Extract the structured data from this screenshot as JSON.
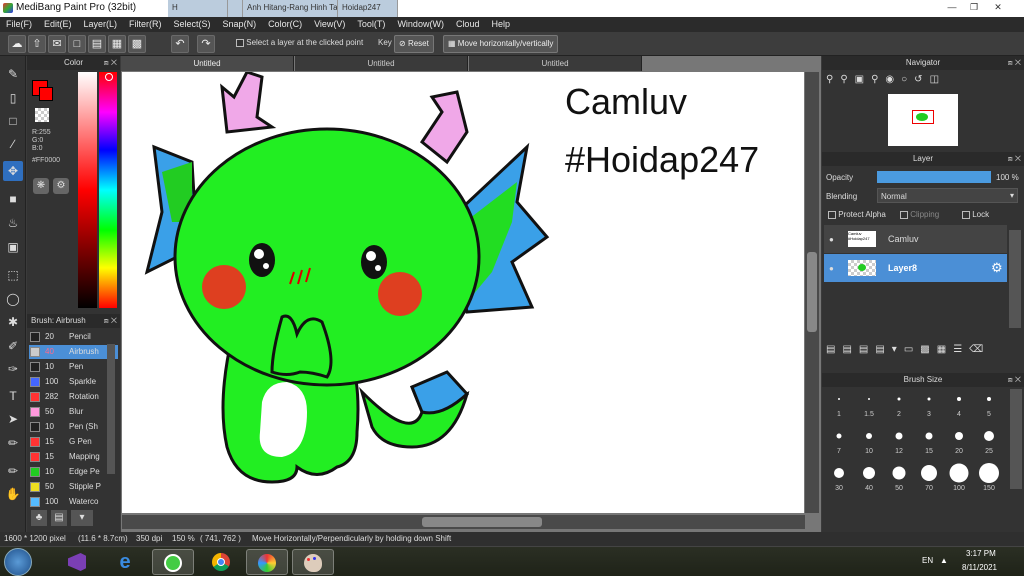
{
  "window": {
    "title": "MediBang Paint Pro (32bit)",
    "browser_tabs": [
      "H",
      "",
      "Anh Hitang-Rang Hinh Tai",
      "Hoidap247"
    ]
  },
  "menu": [
    "File(F)",
    "Edit(E)",
    "Layer(L)",
    "Filter(R)",
    "Select(S)",
    "Snap(N)",
    "Color(C)",
    "View(V)",
    "Tool(T)",
    "Window(W)",
    "Cloud",
    "Help"
  ],
  "toolbar": {
    "select_layer_label": "Select a layer at the clicked point",
    "key_label": "Key",
    "reset_label": "Reset",
    "move_label": "Move horizontally/vertically"
  },
  "color_panel": {
    "title": "Color",
    "r": "R:255",
    "g": "G:0",
    "b": "B:0",
    "hex": "#FF0000",
    "primary": "#ff0000"
  },
  "brush_panel": {
    "title": "Brush: Airbrush",
    "items": [
      {
        "size": "20",
        "name": "Pencil",
        "color": "#222222"
      },
      {
        "size": "40",
        "name": "Airbrush",
        "color": "#cccccc"
      },
      {
        "size": "10",
        "name": "Pen",
        "color": "#222222"
      },
      {
        "size": "100",
        "name": "Sparkle",
        "color": "#4466ff"
      },
      {
        "size": "282",
        "name": "Rotation",
        "color": "#ff3333"
      },
      {
        "size": "50",
        "name": "Blur",
        "color": "#ff99dd"
      },
      {
        "size": "10",
        "name": "Pen (Sh",
        "color": "#222222"
      },
      {
        "size": "15",
        "name": "G Pen",
        "color": "#ff3333"
      },
      {
        "size": "15",
        "name": "Mapping",
        "color": "#ff3333"
      },
      {
        "size": "10",
        "name": "Edge Pe",
        "color": "#22cc22"
      },
      {
        "size": "50",
        "name": "Stipple P",
        "color": "#eedd22"
      },
      {
        "size": "100",
        "name": "Waterco",
        "color": "#55bbff"
      }
    ]
  },
  "documents": {
    "tabs": [
      "Untitled",
      "Untitled",
      "Untitled"
    ],
    "active_tab": 0
  },
  "canvas_text": {
    "line1": "Camluv",
    "line2": "#Hoidap247"
  },
  "navigator": {
    "title": "Navigator"
  },
  "layer_panel": {
    "title": "Layer",
    "opacity_label": "Opacity",
    "opacity_value": "100 %",
    "opacity_fraction": 1.0,
    "blending_label": "Blending",
    "blending_value": "Normal",
    "protect_alpha": "Protect Alpha",
    "clipping": "Clipping",
    "lock": "Lock",
    "layers": [
      {
        "name": "Camluv",
        "thumb": "Camluv #Hoidap247",
        "selected": false
      },
      {
        "name": "Layer8",
        "selected": true
      }
    ]
  },
  "brush_size": {
    "title": "Brush Size",
    "sizes": [
      "1",
      "1.5",
      "2",
      "3",
      "4",
      "5",
      "7",
      "10",
      "12",
      "15",
      "20",
      "25",
      "30",
      "40",
      "50",
      "70",
      "100",
      "150"
    ]
  },
  "status": {
    "dimensions": "1600 * 1200 pixel",
    "physical": "(11.6 * 8.7cm)",
    "dpi": "350 dpi",
    "zoom": "150 %",
    "coords": "( 741, 762 )",
    "hint": "Move Horizontally/Perpendicularly by holding down Shift"
  },
  "taskbar": {
    "lang": "EN",
    "time": "3:17 PM",
    "date": "8/11/2021"
  }
}
